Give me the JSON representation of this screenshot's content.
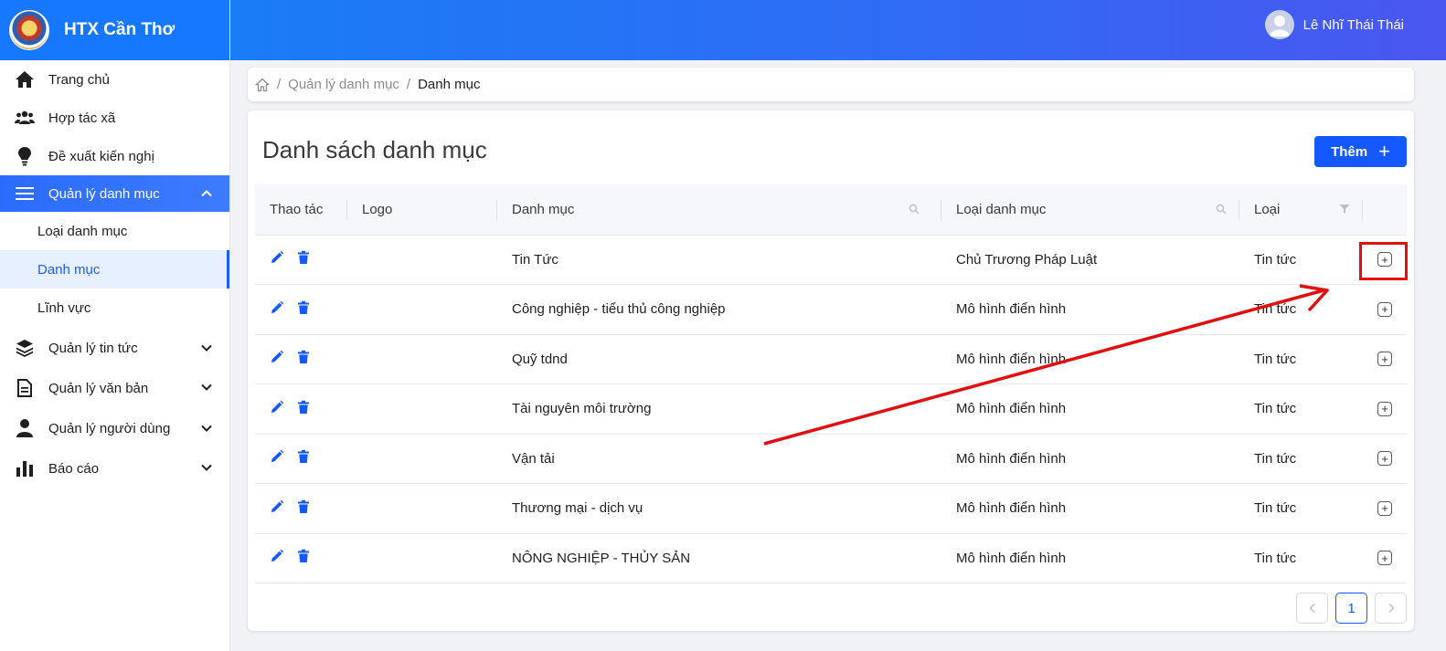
{
  "brand": {
    "name": "HTX Cần Thơ"
  },
  "user": {
    "name": "Lê Nhĩ Thái Thái"
  },
  "sidebar": {
    "items": [
      {
        "label": "Trang chủ",
        "icon": "home-icon"
      },
      {
        "label": "Hợp tác xã",
        "icon": "users-icon"
      },
      {
        "label": "Đề xuất kiến nghị",
        "icon": "lightbulb-icon"
      },
      {
        "label": "Quản lý danh mục",
        "icon": "menu-icon",
        "expanded": true,
        "children": [
          "Loại danh mục",
          "Danh mục",
          "Lĩnh vực"
        ],
        "active_child": "Danh mục"
      },
      {
        "label": "Quản lý tin tức",
        "icon": "layers-icon"
      },
      {
        "label": "Quản lý văn bản",
        "icon": "document-icon"
      },
      {
        "label": "Quản lý người dùng",
        "icon": "user-icon"
      },
      {
        "label": "Báo cáo",
        "icon": "bar-chart-icon"
      }
    ]
  },
  "breadcrumb": {
    "items": [
      "Quản lý danh mục",
      "Danh mục"
    ]
  },
  "page": {
    "title": "Danh sách danh mục",
    "add_label": "Thêm"
  },
  "table": {
    "columns": [
      "Thao tác",
      "Logo",
      "Danh mục",
      "Loại danh mục",
      "Loại"
    ],
    "rows": [
      {
        "logo": "",
        "danh_muc": "Tin Tức",
        "loai_danh_muc": "Chủ Trương Pháp Luật",
        "loai": "Tin tức"
      },
      {
        "logo": "",
        "danh_muc": "Công nghiệp - tiểu thủ công nghiệp",
        "loai_danh_muc": "Mô hình điển hình",
        "loai": "Tin tức"
      },
      {
        "logo": "",
        "danh_muc": "Quỹ tdnd",
        "loai_danh_muc": "Mô hình điển hình",
        "loai": "Tin tức"
      },
      {
        "logo": "",
        "danh_muc": "Tài nguyên môi trường",
        "loai_danh_muc": "Mô hình điển hình",
        "loai": "Tin tức"
      },
      {
        "logo": "",
        "danh_muc": "Vận tải",
        "loai_danh_muc": "Mô hình điển hình",
        "loai": "Tin tức"
      },
      {
        "logo": "",
        "danh_muc": "Thương mại - dịch vụ",
        "loai_danh_muc": "Mô hình điển hình",
        "loai": "Tin tức"
      },
      {
        "logo": "",
        "danh_muc": "NÔNG NGHIỆP - THỦY SẢN",
        "loai_danh_muc": "Mô hình điển hình",
        "loai": "Tin tức"
      }
    ]
  },
  "pagination": {
    "current_page": "1"
  },
  "colors": {
    "primary": "#1459ff",
    "header_start": "#1a7cf7",
    "header_end": "#4a56f0",
    "annotation": "#e01010"
  }
}
